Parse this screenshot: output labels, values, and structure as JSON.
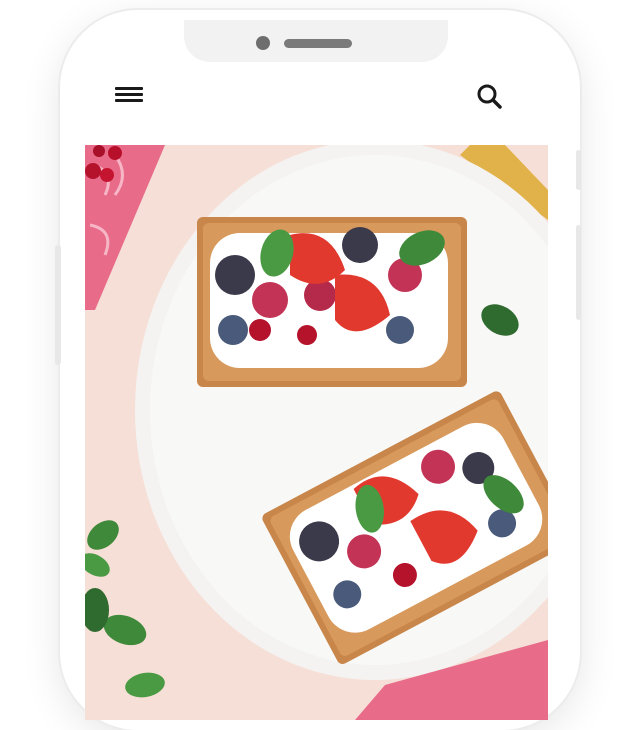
{
  "app": {
    "header": {
      "menu_icon": "hamburger-menu-icon",
      "search_icon": "search-icon"
    },
    "hero_image": {
      "subject": "puff-pastry-berry-tarts-on-white-plate",
      "alt": ""
    }
  },
  "colors": {
    "background": "#ffffff",
    "phone_frame": "#ffffff",
    "notch": "#f2f2f2",
    "icon": "#1a1a1a",
    "table_surface": "#f6dfd6",
    "plate": "#f4f3f2",
    "pastry": "#c8864a",
    "cream": "#ffffff",
    "strawberry": "#e2392f",
    "napkin": "#e86b8a",
    "mint": "#3f8a3a"
  }
}
